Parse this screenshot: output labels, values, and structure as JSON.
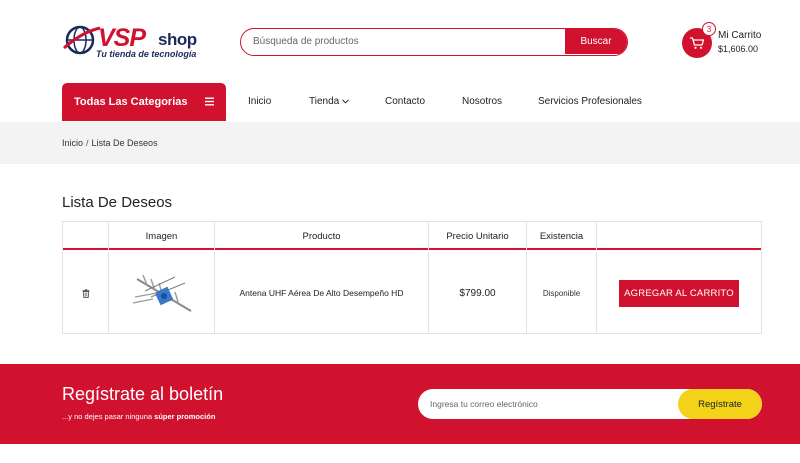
{
  "header": {
    "logo": {
      "brand": "VSP",
      "suffix": "shop",
      "tagline": "Tu tienda de tecnología"
    },
    "search": {
      "placeholder": "Búsqueda de productos",
      "button_label": "Buscar"
    },
    "cart": {
      "count": "3",
      "title": "Mi Carrito",
      "total": "$1,606.00"
    }
  },
  "nav": {
    "categories_label": "Todas Las Categorias",
    "items": [
      {
        "label": "Inicio"
      },
      {
        "label": "Tienda",
        "has_dropdown": true
      },
      {
        "label": "Contacto"
      },
      {
        "label": "Nosotros"
      },
      {
        "label": "Servicios Profesionales"
      }
    ]
  },
  "breadcrumb": {
    "home": "Inicio",
    "separator": "/",
    "current": "Lista De Deseos"
  },
  "wishlist": {
    "title": "Lista De Deseos",
    "columns": [
      "",
      "Imagen",
      "Producto",
      "Precio Unitario",
      "Existencia",
      ""
    ],
    "rows": [
      {
        "product": "Antena UHF Aérea De Alto Desempeño HD",
        "price": "$799.00",
        "stock": "Disponible",
        "action": "AGREGAR AL CARRITO"
      }
    ]
  },
  "newsletter": {
    "title": "Regístrate al boletín",
    "subtitle_prefix": "...y no dejes pasar ninguna",
    "subtitle_bold": "súper promoción",
    "placeholder": "Ingresa tu correo electrónico",
    "button_label": "Regístrate"
  },
  "colors": {
    "primary": "#d1122f",
    "accent": "#f3d21a",
    "navy": "#1b2a5c",
    "crumb_bg": "#f3f3f3"
  }
}
